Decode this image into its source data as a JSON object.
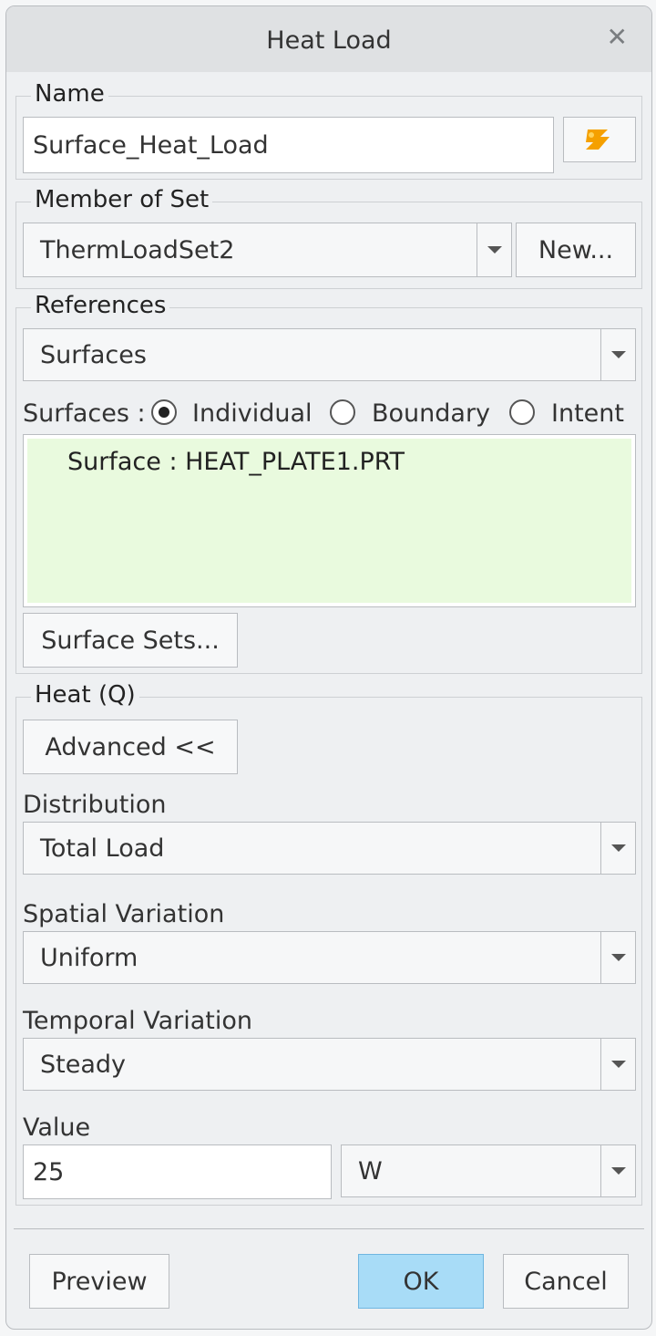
{
  "dialog": {
    "title": "Heat Load"
  },
  "name_group": {
    "label": "Name",
    "value": "Surface_Heat_Load"
  },
  "member_group": {
    "label": "Member of Set",
    "selected": "ThermLoadSet2",
    "new_button": "New..."
  },
  "references_group": {
    "label": "References",
    "selected": "Surfaces",
    "surfaces_label": "Surfaces :",
    "radio_options": [
      "Individual",
      "Boundary",
      "Intent"
    ],
    "radio_selected": "Individual",
    "list_items": [
      "Surface : HEAT_PLATE1.PRT"
    ],
    "surface_sets_button": "Surface Sets..."
  },
  "heat_group": {
    "label": "Heat (Q)",
    "advanced_button": "Advanced <<",
    "distribution": {
      "label": "Distribution",
      "selected": "Total Load"
    },
    "spatial": {
      "label": "Spatial Variation",
      "selected": "Uniform"
    },
    "temporal": {
      "label": "Temporal Variation",
      "selected": "Steady"
    },
    "value": {
      "label": "Value",
      "amount": "25",
      "unit": "W"
    }
  },
  "footer": {
    "preview_button": "Preview",
    "ok_button": "OK",
    "cancel_button": "Cancel"
  },
  "colors": {
    "ok_button": "#a8dcf7",
    "list_background": "#e9fade",
    "icon_orange": "#f5a000"
  }
}
